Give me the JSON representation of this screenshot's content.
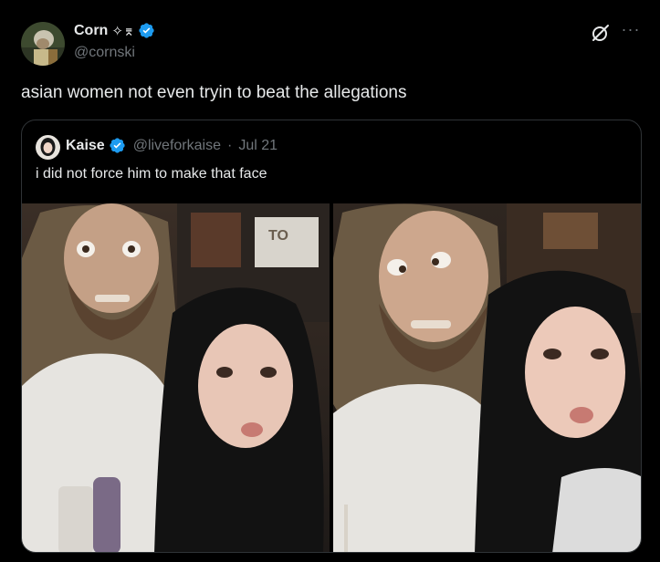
{
  "author": {
    "display_name": "Corn",
    "name_emoji": "✧⌆",
    "handle": "@cornski",
    "verified": true,
    "avatar_icon": "avatar-image"
  },
  "actions": {
    "grok_icon": "grok-icon",
    "more_icon": "more-icon"
  },
  "tweet": {
    "text": "asian women not even tryin to beat the allegations"
  },
  "quote": {
    "display_name": "Kaise",
    "handle": "@liveforkaise",
    "separator": "·",
    "date": "Jul 21",
    "verified": true,
    "text": "i did not force him to make that face",
    "photos": [
      "photo-1",
      "photo-2"
    ],
    "storefront_sign": "TO"
  },
  "colors": {
    "background": "#000000",
    "text": "#e7e9ea",
    "secondary": "#71767b",
    "border": "#2f3336",
    "verified_blue": "#1d9bf0"
  }
}
